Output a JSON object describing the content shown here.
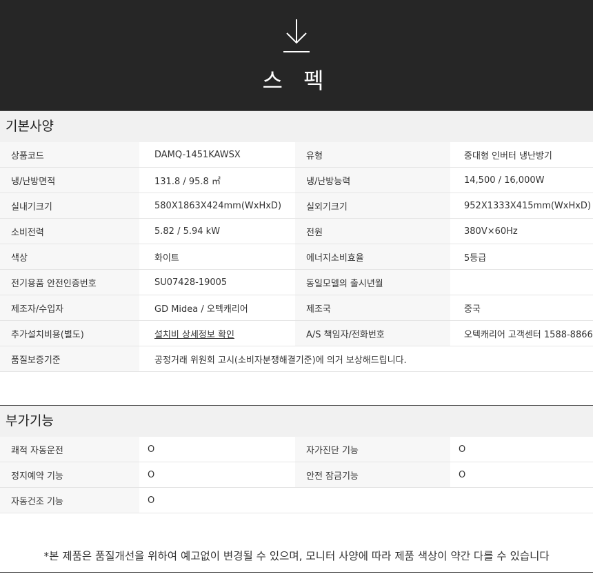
{
  "header": {
    "title": "스 펙",
    "icon": "download-arrow-icon",
    "background": "#262626"
  },
  "basic_spec": {
    "heading": "기본사양",
    "rows": [
      {
        "label1": "상품코드",
        "value1": "DAMQ-1451KAWSX",
        "label2": "유형",
        "value2": "중대형 인버터 냉난방기"
      },
      {
        "label1": "냉/난방면적",
        "value1": "131.8 / 95.8 ㎡",
        "label2": "냉/난방능력",
        "value2": "14,500 / 16,000W"
      },
      {
        "label1": "실내기크기",
        "value1": "580X1863X424mm(WxHxD)",
        "label2": "실외기크기",
        "value2": "952X1333X415mm(WxHxD)"
      },
      {
        "label1": "소비전력",
        "value1": "5.82 / 5.94 kW",
        "label2": "전원",
        "value2": "380V×60Hz"
      },
      {
        "label1": "색상",
        "value1": "화이트",
        "label2": "에너지소비효율",
        "value2": "5등급"
      },
      {
        "label1": "전기용품 안전인증번호",
        "value1": "SU07428-19005",
        "label2": "동일모델의 출시년월",
        "value2": ""
      },
      {
        "label1": "제조자/수입자",
        "value1": "GD Midea / 오텍캐리어",
        "label2": "제조국",
        "value2": "중국"
      },
      {
        "label1": "추가설치비용(별도)",
        "value1": "설치비 상세정보 확인",
        "label2": "A/S 책임자/전화번호",
        "value2": "오텍캐리어 고객센터 1588-8866"
      }
    ],
    "warranty": {
      "label": "품질보증기준",
      "value": "공정거래 위원회 고시(소비자분쟁해결기준)에 의거 보상해드립니다."
    }
  },
  "features": {
    "heading": "부가기능",
    "rows": [
      {
        "label1": "쾌적 자동운전",
        "value1": "O",
        "label2": "자가진단 기능",
        "value2": "O"
      },
      {
        "label1": "정지예약 기능",
        "value1": "O",
        "label2": "안전 잠금기능",
        "value2": "O"
      },
      {
        "label1": "자동건조 기능",
        "value1": "O",
        "label2": "",
        "value2": ""
      }
    ]
  },
  "footnote": "*본 제품은 품질개선을 위하여 예고없이 변경될 수 있으며, 모니터 사양에 따라 제품 색상이 약간 다를 수 있습니다"
}
